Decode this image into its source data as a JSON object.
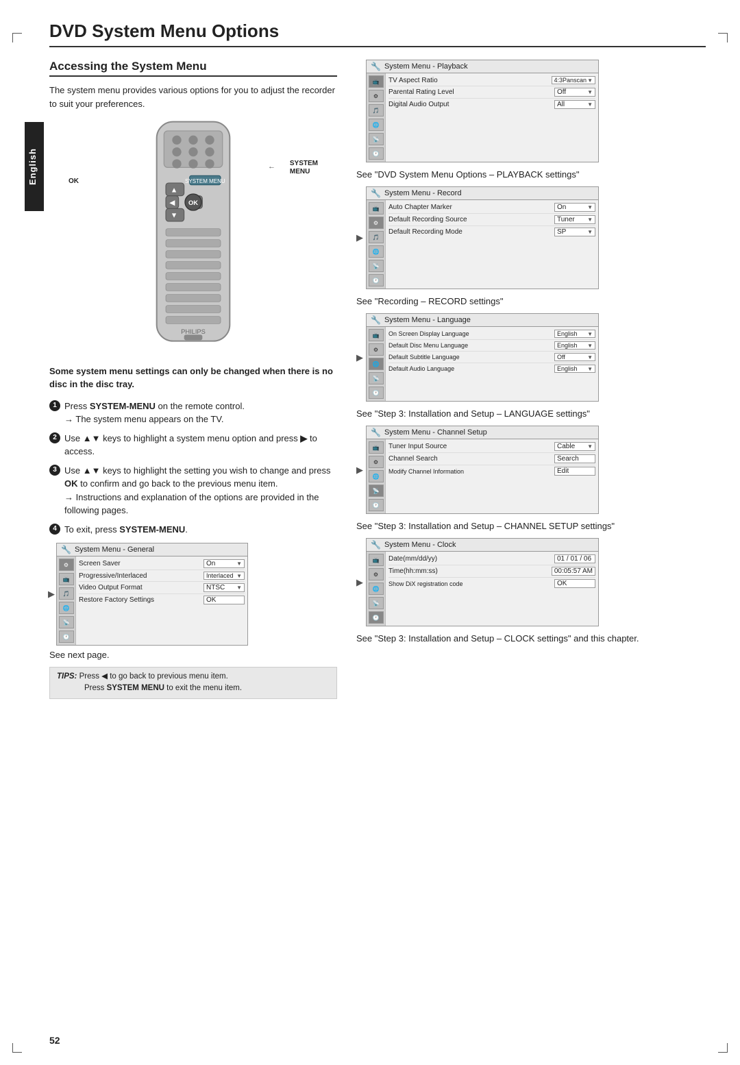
{
  "page": {
    "title": "DVD System Menu Options",
    "page_number": "52",
    "sidebar_label": "English"
  },
  "left_col": {
    "section_heading": "Accessing the System Menu",
    "intro_text": "The system menu provides various options for you to adjust the recorder to suit your preferences.",
    "remote_label_line1": "SYSTEM",
    "remote_label_line2": "MENU",
    "remote_ok_label": "OK",
    "warning_text": "Some system menu settings can only be changed when there is no disc in the disc tray.",
    "steps": [
      {
        "num": "1",
        "text": "Press SYSTEM-MENU on the remote control.",
        "sub": "→ The system menu appears on the TV."
      },
      {
        "num": "2",
        "text": "Use ▲▼ keys to highlight a system menu option and press ▶ to access."
      },
      {
        "num": "3",
        "text": "Use ▲▼ keys to highlight the setting you wish to change and press OK to confirm and go back to the previous menu item.",
        "sub": "→ Instructions and explanation of the options are provided in the following pages."
      },
      {
        "num": "4",
        "text": "To exit, press SYSTEM-MENU."
      }
    ],
    "small_menu": {
      "title": "System Menu - General",
      "rows": [
        {
          "label": "Screen Saver",
          "value": "On"
        },
        {
          "label": "Progressive/Interlaced",
          "value": "Interlaced"
        },
        {
          "label": "Video Output Format",
          "value": "NTSC"
        },
        {
          "label": "Restore Factory Settings",
          "value": "OK"
        }
      ]
    },
    "see_next": "See next page."
  },
  "right_col": {
    "menus": [
      {
        "title": "System Menu - Playback",
        "rows": [
          {
            "label": "TV Aspect Ratio",
            "value": "4:3Panscan"
          },
          {
            "label": "Parental Rating Level",
            "value": "Off"
          },
          {
            "label": "Digital Audio Output",
            "value": "All"
          }
        ],
        "caption": "See \"DVD System Menu Options – PLAYBACK settings\""
      },
      {
        "title": "System Menu - Record",
        "rows": [
          {
            "label": "Auto Chapter Marker",
            "value": "On"
          },
          {
            "label": "Default Recording Source",
            "value": "Tuner"
          },
          {
            "label": "Default Recording Mode",
            "value": "SP"
          }
        ],
        "caption": "See \"Recording – RECORD settings\""
      },
      {
        "title": "System Menu - Language",
        "rows": [
          {
            "label": "On Screen Display Language",
            "value": "English"
          },
          {
            "label": "Default Disc Menu Language",
            "value": "English"
          },
          {
            "label": "Default Subtitle Language",
            "value": "Off"
          },
          {
            "label": "Default Audio Language",
            "value": "English"
          }
        ],
        "caption": "See \"Step 3: Installation and Setup – LANGUAGE settings\""
      },
      {
        "title": "System Menu - Channel Setup",
        "rows": [
          {
            "label": "Tuner Input Source",
            "value": "Cable"
          },
          {
            "label": "Channel Search",
            "value": "Search"
          },
          {
            "label": "Modify Channel Information",
            "value": "Edit"
          }
        ],
        "caption": "See \"Step 3: Installation and Setup – CHANNEL SETUP settings\""
      },
      {
        "title": "System Menu - Clock",
        "rows": [
          {
            "label": "Date(mm/dd/yy)",
            "value": "01 / 01 / 06"
          },
          {
            "label": "Time(hh:mm:ss)",
            "value": "00:05:57 AM"
          },
          {
            "label": "Show DiX registration code",
            "value": "OK"
          }
        ],
        "caption": "See \"Step 3: Installation and Setup – CLOCK settings\" and this chapter."
      }
    ]
  },
  "tips": {
    "label": "TIPS:",
    "lines": [
      "Press ◀ to go back to previous menu item.",
      "Press SYSTEM MENU to exit the menu item."
    ]
  }
}
